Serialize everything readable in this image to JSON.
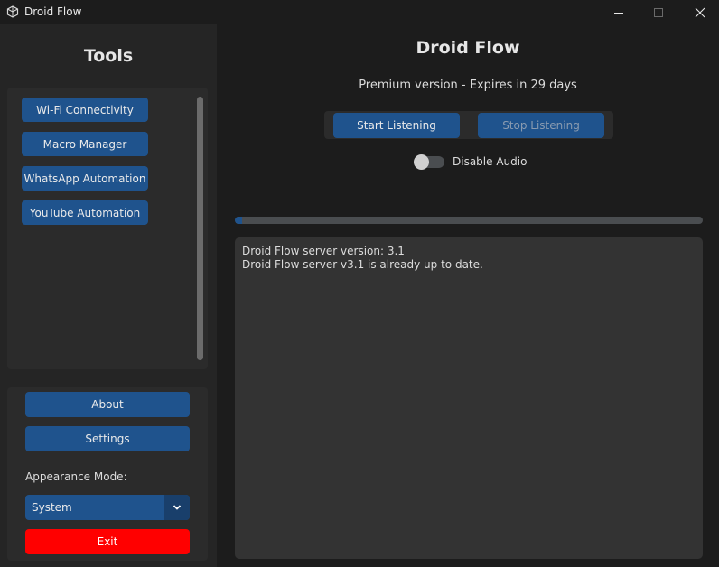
{
  "window": {
    "title": "Droid Flow",
    "icons": {
      "app": "app-logo-icon",
      "minimize": "minimize-icon",
      "maximize": "maximize-icon",
      "close": "close-icon"
    }
  },
  "sidebar": {
    "title": "Tools",
    "tools": [
      {
        "label": "Wi-Fi Connectivity"
      },
      {
        "label": "Macro Manager"
      },
      {
        "label": "WhatsApp Automation"
      },
      {
        "label": "YouTube Automation"
      }
    ],
    "about_label": "About",
    "settings_label": "Settings",
    "appearance_label": "Appearance Mode:",
    "appearance_value": "System",
    "exit_label": "Exit"
  },
  "main": {
    "title": "Droid Flow",
    "subtitle": "Premium version - Expires in 29 days",
    "start_label": "Start Listening",
    "stop_label": "Stop Listening",
    "audio_toggle_label": "Disable Audio",
    "audio_toggle_on": false,
    "progress_fraction": 0.015,
    "log_lines": [
      "Droid Flow server version: 3.1",
      "Droid Flow server v3.1 is already up to date."
    ]
  },
  "colors": {
    "accent": "#1f538d",
    "accent_dark": "#193f6b",
    "exit": "#ff0000",
    "background": "#1c1c1c",
    "panel": "#2b2b2b",
    "log_bg": "#333333"
  }
}
